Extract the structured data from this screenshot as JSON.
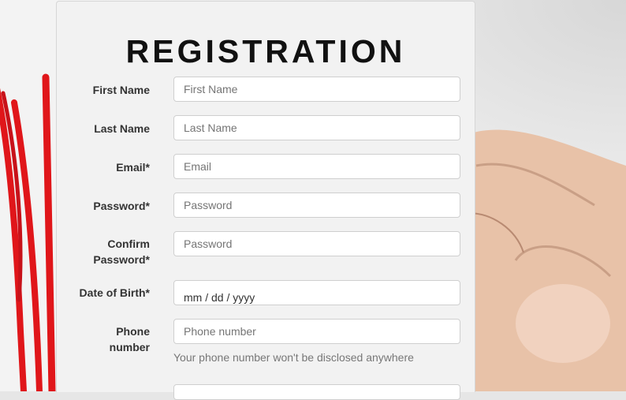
{
  "form": {
    "title": "REGISTRATION",
    "fields": [
      {
        "label": "First Name",
        "placeholder": "First Name"
      },
      {
        "label": "Last Name",
        "placeholder": "Last Name"
      },
      {
        "label": "Email*",
        "placeholder": "Email"
      },
      {
        "label": "Password*",
        "placeholder": "Password"
      },
      {
        "label_line1": "Confirm",
        "label_line2": "Password*",
        "placeholder": "Password"
      },
      {
        "label": "Date of Birth*",
        "value": "mm / dd / yyyy"
      },
      {
        "label_line1": "Phone",
        "label_line2": "number",
        "placeholder": "Phone number",
        "help": "Your phone number won't be disclosed anywhere"
      }
    ]
  },
  "colors": {
    "marker": "#e0161a",
    "panel": "#f2f2f2",
    "title": "#111111"
  }
}
